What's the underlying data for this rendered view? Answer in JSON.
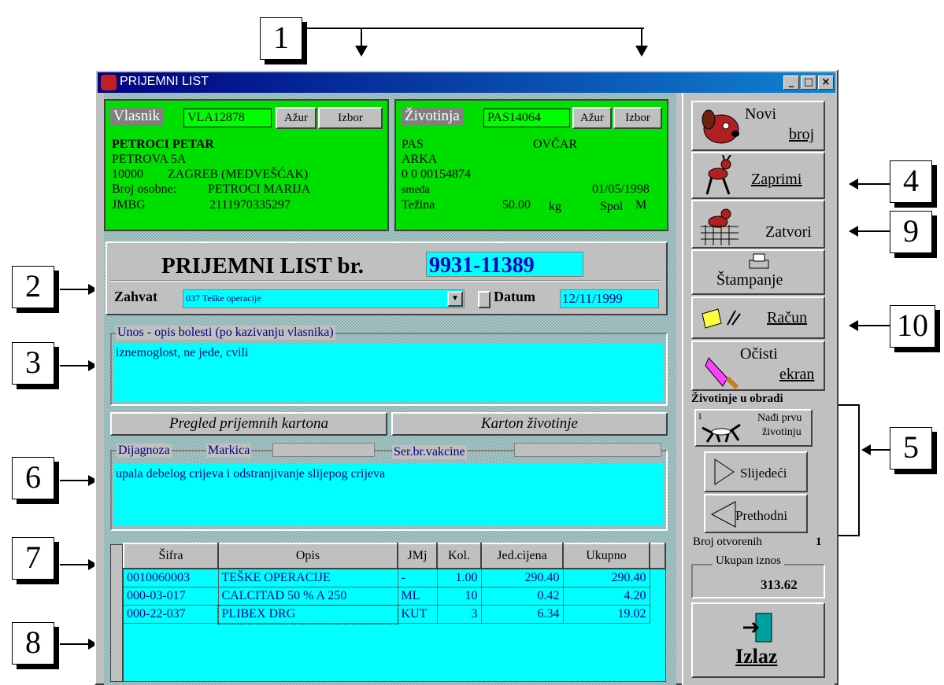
{
  "callouts": [
    "1",
    "2",
    "3",
    "4",
    "5",
    "6",
    "7",
    "8",
    "9",
    "10"
  ],
  "window": {
    "title": "PRIJEMNI LIST",
    "controls": [
      "_",
      "□",
      "×"
    ]
  },
  "owner": {
    "title": "Vlasnik",
    "code": "VLA12878",
    "btn_azur": "Ažur",
    "btn_izbor": "Izbor",
    "name": "PETROCI PETAR",
    "street": "PETROVA 5A",
    "postcode": "10000",
    "city": "ZAGREB (MEDVEŠĆAK)",
    "contact_label": "Broj osobne:",
    "contact_value": "PETROCI MARIJA",
    "jmbg_label": "JMBG",
    "jmbg_value": "2111970335297"
  },
  "animal": {
    "title": "Životinja",
    "code": "PAS14064",
    "btn_azur": "Ažur",
    "btn_izbor": "Izbor",
    "species": "PAS",
    "breed": "OVČAR",
    "name": "ARKA",
    "chip": "0 0 00154874",
    "color": "smeđa",
    "birth": "01/05/1998",
    "weight_label": "Težina",
    "weight_value": "50.00",
    "weight_unit": "kg",
    "sex_label": "Spol",
    "sex_value": "M"
  },
  "sheet": {
    "heading": "PRIJEMNI LIST br.",
    "number": "9931-11389",
    "procedure_label": "Zahvat",
    "procedure_value": "037 Teške operacije",
    "date_label": "Datum",
    "date_value": "12/11/1999"
  },
  "complaint": {
    "label": "Unos - opis bolesti (po kazivanju vlasnika)",
    "text": "iznemoglost, ne jede, cvili"
  },
  "tabs": {
    "review": "Pregled prijemnih kartona",
    "card": "Karton životinje"
  },
  "diagnosis": {
    "label": "Dijagnoza",
    "marker_label": "Markica",
    "vaccine_label": "Ser.br.vakcine",
    "text": "upala debelog crijeva i odstranjivanje slijepog crijeva"
  },
  "table": {
    "headers": [
      "Šifra",
      "Opis",
      "JMj",
      "Kol.",
      "Jed.cijena",
      "Ukupno"
    ],
    "rows": [
      [
        "0010060003",
        "TEŠKE OPERACIJE",
        "-",
        "1.00",
        "290.40",
        "290.40"
      ],
      [
        "000-03-017",
        "CALCITAD 50 % A 250",
        "ML",
        "10",
        "0.42",
        "4.20"
      ],
      [
        "000-22-037",
        "PLIBEX DRG",
        "KUT",
        "3",
        "6.34",
        "19.02"
      ]
    ]
  },
  "sidebar": {
    "new_line1": "Novi",
    "new_line2": "broj",
    "admit": "Zaprimi",
    "close": "Zatvori",
    "print": "Štampanje",
    "invoice": "Račun",
    "clear_line1": "Očisti",
    "clear_line2": "ekran",
    "in_process": "Životinje u obradi",
    "find_num": "1",
    "find_line1": "Nađi prvu",
    "find_line2": "životinju",
    "next": "Slijedeći",
    "prev": "Prethodni",
    "open_label": "Broj otvorenih",
    "open_value": "1",
    "total_label": "Ukupan iznos",
    "total_value": "313.62",
    "exit": "Izlaz"
  }
}
